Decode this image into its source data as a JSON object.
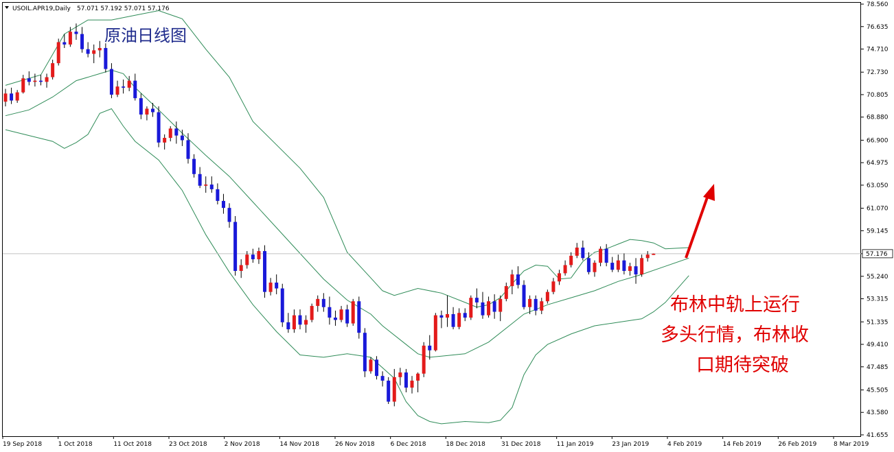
{
  "header": {
    "symbol": "USOIL.APR19,Daily",
    "ohlc": "57.071 57.192 57.071 57.176"
  },
  "annotations": {
    "title": "原油日线图",
    "note_lines": [
      "布林中轨上运行",
      "多头行情，布林收",
      "口期待突破"
    ]
  },
  "colors": {
    "bull": "#e31b1b",
    "bear": "#1919d9",
    "band": "#2e8b57",
    "arrow": "#e00000",
    "title": "#1f2b8c",
    "note": "#e00000",
    "price_line": "#c0c0c0",
    "price_marker": "#ffffff"
  },
  "chart_data": {
    "type": "candlestick",
    "indicator": "Bollinger Bands (upper, middle, lower)",
    "current_price": 57.176,
    "current_price_label": "57.176",
    "ylim": [
      41.655,
      78.56
    ],
    "y_ticks": [
      "78.560",
      "76.635",
      "74.710",
      "72.730",
      "70.805",
      "68.880",
      "66.900",
      "64.975",
      "63.050",
      "61.070",
      "59.145",
      "57.176",
      "55.240",
      "53.315",
      "51.335",
      "49.410",
      "47.485",
      "45.505",
      "43.580",
      "41.655"
    ],
    "x_ticks": [
      "19 Sep 2018",
      "1 Oct 2018",
      "11 Oct 2018",
      "23 Oct 2018",
      "2 Nov 2018",
      "14 Nov 2018",
      "26 Nov 2018",
      "6 Dec 2018",
      "18 Dec 2018",
      "31 Dec 2018",
      "11 Jan 2019",
      "23 Jan 2019",
      "4 Feb 2019",
      "14 Feb 2019",
      "26 Feb 2019",
      "8 Mar 2019"
    ],
    "candles_ohlc": [
      [
        70.2,
        71.3,
        69.8,
        70.9
      ],
      [
        70.9,
        71.4,
        70.0,
        70.3
      ],
      [
        70.3,
        71.2,
        70.1,
        71.0
      ],
      [
        71.0,
        72.5,
        70.9,
        72.2
      ],
      [
        72.2,
        72.8,
        71.6,
        71.9
      ],
      [
        71.9,
        72.6,
        71.5,
        72.0
      ],
      [
        72.0,
        72.5,
        71.6,
        71.9
      ],
      [
        71.9,
        72.6,
        71.4,
        72.3
      ],
      [
        72.3,
        73.8,
        72.1,
        73.5
      ],
      [
        73.5,
        75.6,
        73.3,
        75.3
      ],
      [
        75.3,
        76.0,
        74.8,
        75.1
      ],
      [
        75.1,
        76.6,
        74.9,
        76.2
      ],
      [
        76.2,
        76.9,
        75.5,
        76.0
      ],
      [
        76.0,
        76.6,
        74.4,
        74.7
      ],
      [
        74.7,
        75.3,
        74.0,
        74.3
      ],
      [
        74.3,
        75.1,
        73.5,
        74.6
      ],
      [
        74.6,
        75.4,
        74.0,
        74.8
      ],
      [
        74.8,
        75.2,
        72.7,
        73.0
      ],
      [
        73.0,
        73.5,
        70.5,
        70.8
      ],
      [
        70.8,
        72.0,
        70.6,
        71.5
      ],
      [
        71.5,
        72.1,
        70.9,
        71.4
      ],
      [
        71.4,
        72.4,
        71.1,
        72.0
      ],
      [
        72.0,
        72.6,
        70.3,
        70.5
      ],
      [
        70.5,
        70.9,
        68.7,
        69.1
      ],
      [
        69.1,
        69.8,
        68.6,
        69.6
      ],
      [
        69.6,
        70.1,
        68.9,
        69.3
      ],
      [
        69.3,
        69.8,
        66.3,
        66.7
      ],
      [
        66.7,
        67.4,
        66.1,
        67.1
      ],
      [
        67.1,
        68.1,
        66.8,
        67.9
      ],
      [
        67.9,
        68.5,
        66.6,
        67.3
      ],
      [
        67.3,
        67.8,
        66.4,
        66.9
      ],
      [
        66.9,
        67.5,
        64.9,
        65.3
      ],
      [
        65.3,
        65.7,
        63.7,
        64.0
      ],
      [
        64.0,
        64.6,
        62.8,
        63.0
      ],
      [
        63.0,
        63.8,
        62.4,
        63.1
      ],
      [
        63.1,
        63.8,
        62.4,
        62.7
      ],
      [
        62.7,
        63.2,
        61.4,
        61.7
      ],
      [
        61.7,
        62.3,
        60.6,
        61.1
      ],
      [
        61.1,
        61.5,
        59.4,
        59.9
      ],
      [
        59.9,
        60.4,
        55.3,
        55.7
      ],
      [
        55.7,
        56.7,
        55.1,
        56.2
      ],
      [
        56.2,
        57.4,
        55.9,
        57.1
      ],
      [
        57.1,
        57.6,
        56.4,
        56.7
      ],
      [
        56.7,
        57.7,
        56.3,
        57.4
      ],
      [
        57.4,
        57.9,
        53.4,
        53.9
      ],
      [
        53.9,
        55.1,
        53.6,
        54.7
      ],
      [
        54.7,
        55.4,
        53.7,
        54.2
      ],
      [
        54.2,
        54.6,
        50.9,
        51.3
      ],
      [
        51.3,
        52.1,
        50.4,
        50.7
      ],
      [
        50.7,
        52.4,
        50.4,
        51.9
      ],
      [
        51.9,
        52.4,
        50.7,
        51.1
      ],
      [
        51.1,
        51.9,
        50.4,
        51.5
      ],
      [
        51.5,
        52.9,
        51.3,
        52.7
      ],
      [
        52.7,
        53.6,
        52.2,
        53.3
      ],
      [
        53.3,
        53.8,
        52.2,
        52.6
      ],
      [
        52.6,
        53.5,
        51.1,
        51.7
      ],
      [
        51.7,
        52.3,
        51.0,
        51.5
      ],
      [
        51.5,
        52.7,
        51.3,
        52.4
      ],
      [
        52.4,
        52.8,
        50.9,
        51.2
      ],
      [
        51.2,
        53.3,
        51.0,
        53.1
      ],
      [
        53.1,
        53.5,
        49.9,
        50.4
      ],
      [
        50.4,
        50.8,
        46.6,
        47.1
      ],
      [
        47.1,
        48.3,
        46.9,
        48.1
      ],
      [
        48.1,
        48.4,
        46.4,
        46.7
      ],
      [
        46.7,
        47.1,
        45.8,
        46.3
      ],
      [
        46.3,
        46.6,
        44.3,
        44.5
      ],
      [
        44.5,
        47.3,
        44.1,
        46.6
      ],
      [
        46.6,
        47.4,
        45.9,
        47.0
      ],
      [
        47.0,
        47.3,
        45.3,
        45.7
      ],
      [
        45.7,
        46.7,
        45.2,
        46.3
      ],
      [
        46.3,
        47.0,
        45.3,
        46.9
      ],
      [
        46.9,
        49.6,
        46.6,
        49.3
      ],
      [
        49.3,
        50.2,
        48.1,
        48.9
      ],
      [
        48.9,
        52.1,
        48.8,
        51.9
      ],
      [
        51.9,
        52.3,
        50.8,
        51.7
      ],
      [
        51.7,
        53.6,
        50.9,
        52.0
      ],
      [
        52.0,
        52.6,
        50.7,
        50.9
      ],
      [
        50.9,
        52.5,
        50.7,
        52.1
      ],
      [
        52.1,
        52.5,
        51.4,
        51.7
      ],
      [
        51.7,
        53.6,
        51.5,
        53.4
      ],
      [
        53.4,
        54.2,
        52.5,
        53.0
      ],
      [
        53.0,
        53.9,
        51.6,
        51.9
      ],
      [
        51.9,
        53.5,
        51.7,
        53.1
      ],
      [
        53.1,
        53.7,
        51.6,
        52.2
      ],
      [
        52.2,
        53.6,
        51.4,
        53.3
      ],
      [
        53.3,
        54.7,
        53.1,
        54.4
      ],
      [
        54.4,
        55.8,
        53.7,
        55.4
      ],
      [
        55.4,
        56.1,
        54.2,
        54.5
      ],
      [
        54.5,
        54.9,
        52.4,
        52.6
      ],
      [
        52.6,
        53.6,
        52.0,
        53.3
      ],
      [
        53.3,
        53.6,
        51.9,
        52.3
      ],
      [
        52.3,
        53.4,
        52.0,
        53.1
      ],
      [
        53.1,
        54.1,
        52.9,
        53.9
      ],
      [
        53.9,
        55.1,
        53.7,
        54.8
      ],
      [
        54.8,
        55.8,
        54.5,
        55.5
      ],
      [
        55.5,
        56.6,
        55.3,
        56.2
      ],
      [
        56.2,
        57.3,
        56.0,
        57.0
      ],
      [
        57.0,
        58.1,
        56.8,
        57.7
      ],
      [
        57.7,
        58.3,
        56.6,
        56.8
      ],
      [
        56.8,
        57.3,
        55.4,
        55.6
      ],
      [
        55.6,
        56.6,
        55.2,
        56.4
      ],
      [
        56.4,
        57.8,
        56.1,
        57.6
      ],
      [
        57.6,
        58.0,
        56.1,
        56.4
      ],
      [
        56.4,
        56.9,
        55.6,
        55.8
      ],
      [
        55.8,
        57.1,
        55.6,
        56.6
      ],
      [
        56.6,
        57.2,
        55.4,
        55.7
      ],
      [
        55.7,
        56.4,
        55.3,
        56.1
      ],
      [
        56.1,
        56.8,
        54.6,
        55.4
      ],
      [
        55.4,
        57.1,
        55.2,
        56.8
      ],
      [
        56.8,
        57.4,
        56.5,
        57.1
      ],
      [
        57.071,
        57.192,
        57.071,
        57.176
      ]
    ],
    "bollinger": {
      "upper": [
        [
          0,
          71.6
        ],
        [
          6,
          72.5
        ],
        [
          10,
          76.0
        ],
        [
          14,
          77.2
        ],
        [
          18,
          77.2
        ],
        [
          22,
          77.6
        ],
        [
          26,
          78.0
        ],
        [
          30,
          77.3
        ],
        [
          34,
          74.7
        ],
        [
          38,
          72.3
        ],
        [
          42,
          68.5
        ],
        [
          46,
          66.5
        ],
        [
          50,
          64.5
        ],
        [
          54,
          62.0
        ],
        [
          58,
          57.3
        ],
        [
          62,
          55.1
        ],
        [
          64,
          54.0
        ],
        [
          66,
          53.6
        ],
        [
          70,
          54.2
        ],
        [
          74,
          53.8
        ],
        [
          78,
          53.0
        ],
        [
          80,
          52.6
        ],
        [
          82,
          52.8
        ],
        [
          84,
          53.4
        ],
        [
          86,
          54.6
        ],
        [
          88,
          55.7
        ],
        [
          90,
          56.2
        ],
        [
          92,
          56.1
        ],
        [
          94,
          55.0
        ],
        [
          96,
          55.1
        ],
        [
          98,
          56.5
        ],
        [
          100,
          57.3
        ],
        [
          102,
          57.6
        ],
        [
          104,
          58.0
        ],
        [
          106,
          58.4
        ],
        [
          108,
          58.3
        ],
        [
          110,
          58.1
        ],
        [
          112,
          57.6
        ],
        [
          116,
          57.7
        ]
      ],
      "middle": [
        [
          0,
          69.0
        ],
        [
          4,
          69.5
        ],
        [
          8,
          70.6
        ],
        [
          12,
          72.0
        ],
        [
          16,
          72.6
        ],
        [
          18,
          72.9
        ],
        [
          20,
          72.6
        ],
        [
          22,
          71.4
        ],
        [
          26,
          69.5
        ],
        [
          30,
          67.5
        ],
        [
          34,
          65.6
        ],
        [
          38,
          63.8
        ],
        [
          42,
          61.6
        ],
        [
          46,
          59.4
        ],
        [
          50,
          57.2
        ],
        [
          54,
          55.0
        ],
        [
          58,
          53.2
        ],
        [
          62,
          52.0
        ],
        [
          64,
          51.0
        ],
        [
          68,
          49.4
        ],
        [
          70,
          48.6
        ],
        [
          72,
          48.3
        ],
        [
          74,
          48.4
        ],
        [
          78,
          48.6
        ],
        [
          82,
          49.6
        ],
        [
          86,
          51.2
        ],
        [
          88,
          52.0
        ],
        [
          92,
          52.8
        ],
        [
          96,
          53.4
        ],
        [
          100,
          54.0
        ],
        [
          104,
          54.8
        ],
        [
          108,
          55.4
        ],
        [
          112,
          56.1
        ],
        [
          116,
          56.8
        ]
      ],
      "lower": [
        [
          0,
          67.8
        ],
        [
          4,
          67.3
        ],
        [
          8,
          66.8
        ],
        [
          10,
          66.2
        ],
        [
          12,
          66.7
        ],
        [
          14,
          67.4
        ],
        [
          16,
          69.2
        ],
        [
          18,
          69.6
        ],
        [
          20,
          68.1
        ],
        [
          22,
          66.8
        ],
        [
          26,
          65.2
        ],
        [
          30,
          62.6
        ],
        [
          34,
          58.8
        ],
        [
          38,
          55.6
        ],
        [
          42,
          52.8
        ],
        [
          46,
          50.5
        ],
        [
          50,
          48.5
        ],
        [
          54,
          48.3
        ],
        [
          58,
          48.6
        ],
        [
          62,
          48.3
        ],
        [
          66,
          46.5
        ],
        [
          68,
          44.5
        ],
        [
          70,
          43.3
        ],
        [
          72,
          42.8
        ],
        [
          74,
          42.6
        ],
        [
          78,
          42.8
        ],
        [
          82,
          42.7
        ],
        [
          84,
          42.9
        ],
        [
          86,
          44.0
        ],
        [
          88,
          46.8
        ],
        [
          90,
          48.5
        ],
        [
          92,
          49.4
        ],
        [
          96,
          50.3
        ],
        [
          100,
          51.0
        ],
        [
          104,
          51.3
        ],
        [
          108,
          51.6
        ],
        [
          110,
          52.2
        ],
        [
          112,
          53.0
        ],
        [
          116,
          55.3
        ]
      ]
    }
  }
}
